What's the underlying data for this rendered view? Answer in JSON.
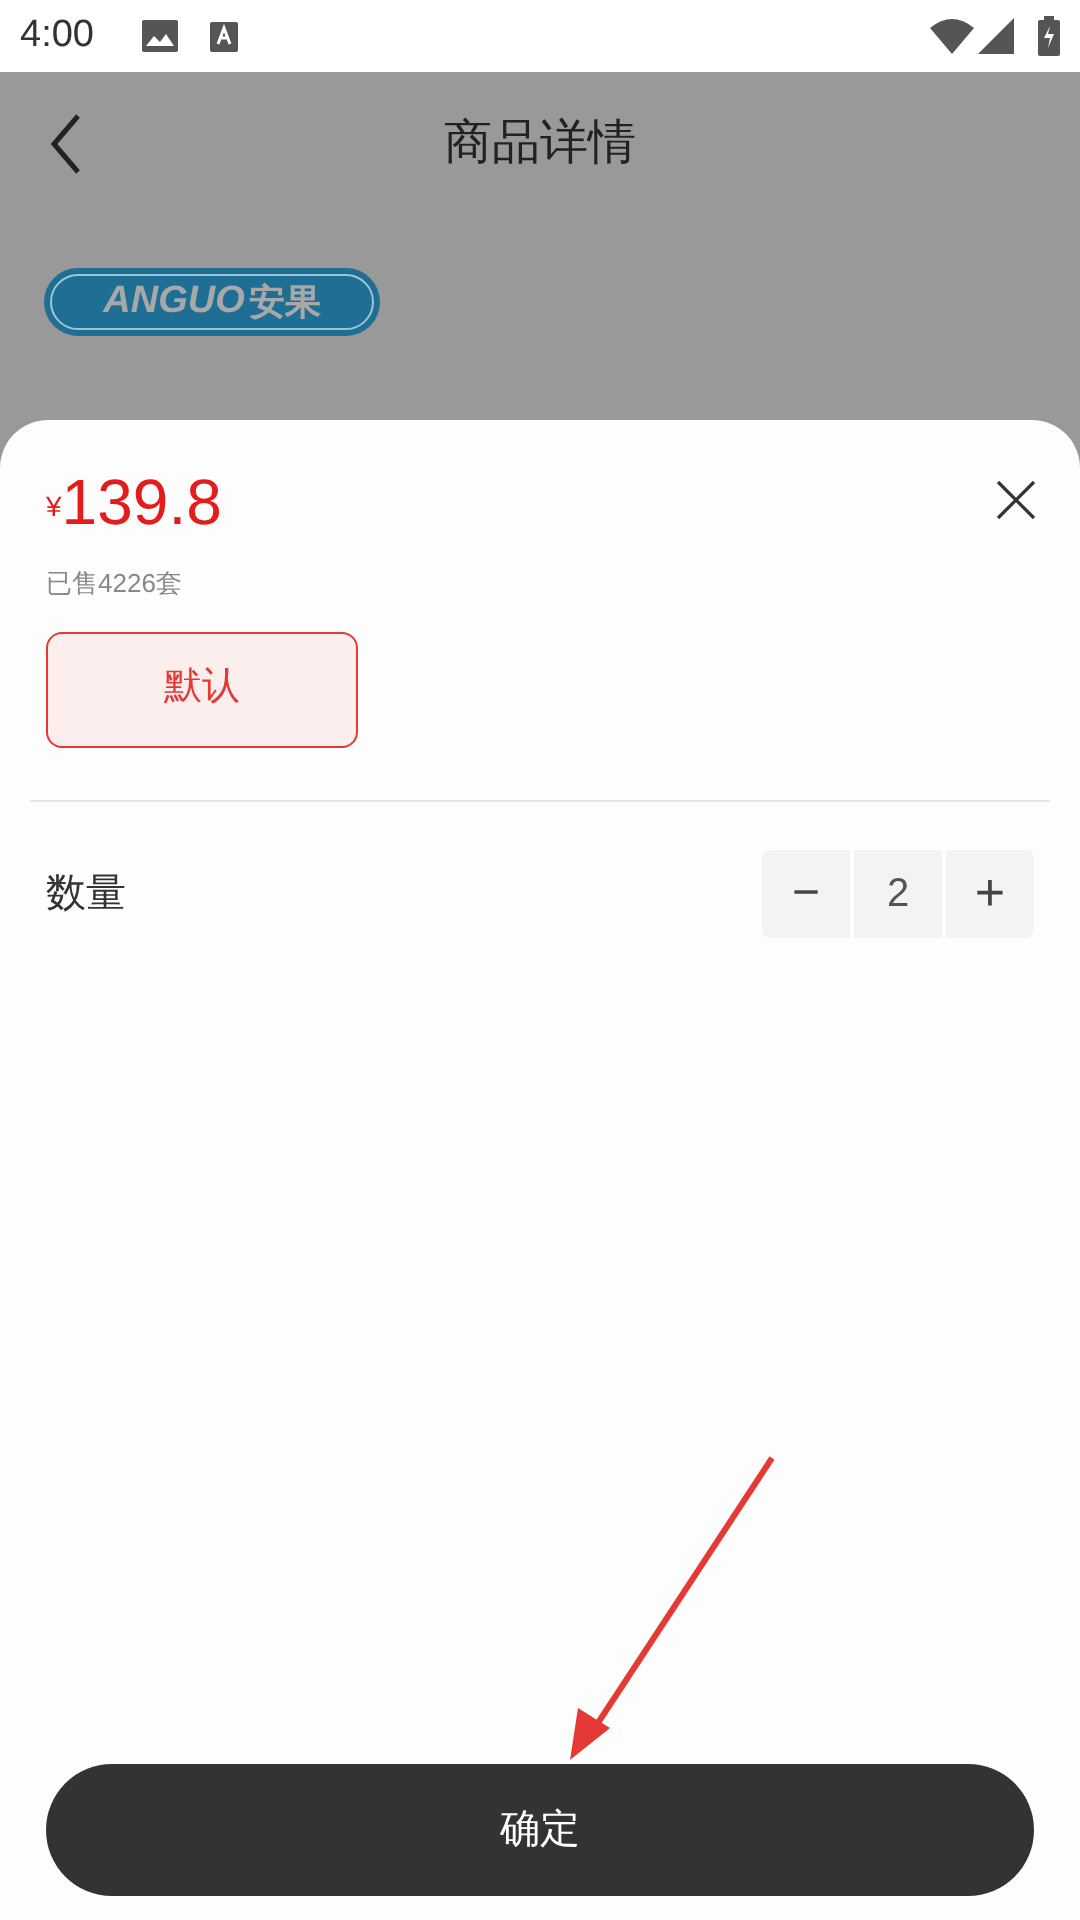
{
  "status_bar": {
    "time": "4:00"
  },
  "header": {
    "title": "商品详情"
  },
  "brand_logo": {
    "latin": "ANGUO",
    "chinese": "安果"
  },
  "sheet": {
    "currency": "¥",
    "price": "139.8",
    "sold": "已售4226套",
    "options": [
      {
        "label": "默认",
        "selected": true
      }
    ],
    "quantity": {
      "label": "数量",
      "minus": "−",
      "value": "2",
      "plus": "+"
    },
    "confirm": "确定"
  }
}
